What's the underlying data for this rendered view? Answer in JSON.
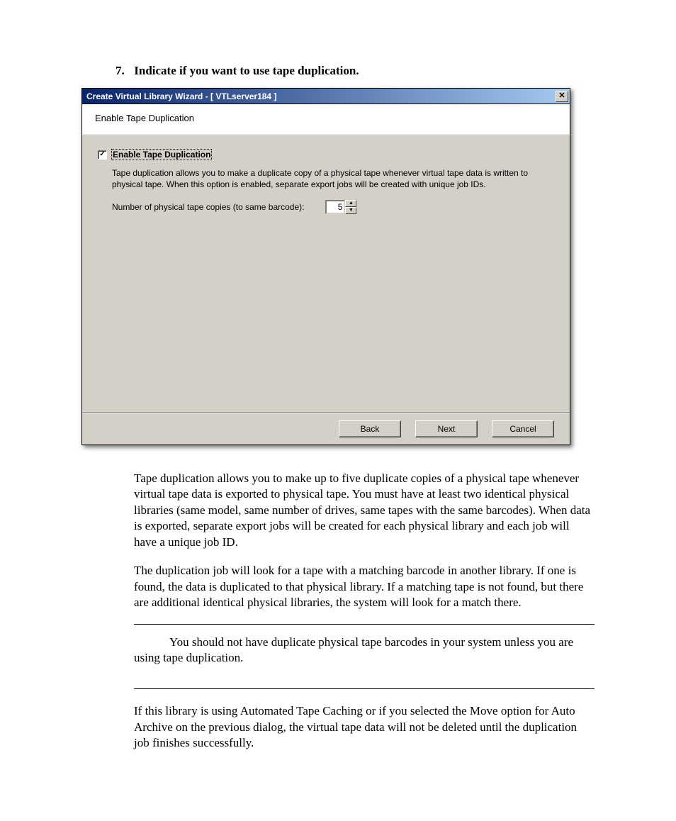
{
  "step": {
    "number": "7.",
    "title": "Indicate if you want to use tape duplication."
  },
  "dialog": {
    "title": "Create Virtual Library Wizard - [ VTLserver184 ]",
    "header": "Enable Tape Duplication",
    "checkbox_checked": "✓",
    "checkbox_label": "Enable Tape Duplication",
    "description": "Tape duplication allows you to make a duplicate copy of a physical tape whenever virtual tape data is written to physical tape. When this option is enabled, separate export jobs will be created with unique job IDs.",
    "copies_label": "Number of physical tape copies (to same barcode):",
    "copies_value": "5",
    "buttons": {
      "back": "Back",
      "next": "Next",
      "cancel": "Cancel"
    }
  },
  "doc": {
    "p1": "Tape duplication allows you to make up to five duplicate copies of a physical tape whenever virtual tape data is exported to physical tape. You must have at least two identical physical libraries (same model, same number of drives, same tapes with the same barcodes). When data is exported, separate export jobs will be created for each physical library and each job will have a unique job ID.",
    "p2": "The duplication job will look for a tape with a matching barcode in another library. If one is found, the data is duplicated to that physical library. If a matching tape is not found, but there are additional identical physical libraries, the system will look for a match there.",
    "note": "You should not have duplicate physical tape barcodes in your system unless you are using tape duplication.",
    "p3": "If this library is using Automated Tape Caching or if you selected the Move option for Auto Archive on the previous dialog, the virtual tape data will not be deleted until the duplication job finishes successfully."
  }
}
